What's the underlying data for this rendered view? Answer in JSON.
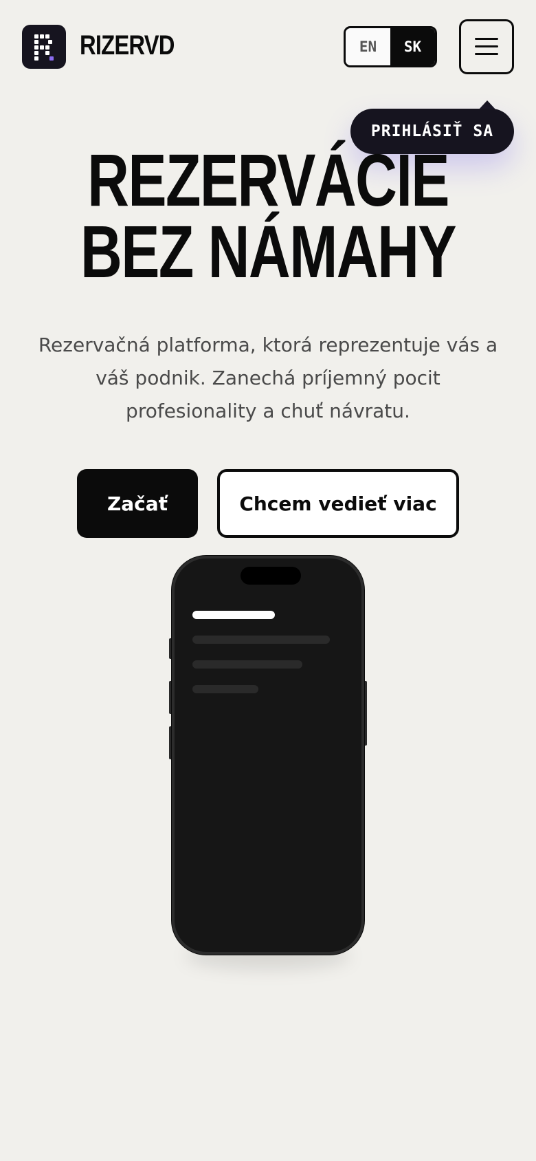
{
  "header": {
    "brand": "RIZERVD",
    "lang": {
      "en": "EN",
      "sk": "SK",
      "active": "SK"
    }
  },
  "tooltip": {
    "label": "PRIHLÁSIŤ SA"
  },
  "hero": {
    "title_line1": "REZERVÁCIE",
    "title_line2": "BEZ NÁMAHY",
    "subtitle": "Rezervačná platforma, ktorá reprezentuje vás a váš podnik. Zanechá príjemný pocit profesionality a chuť návratu.",
    "primary_cta": "Začať",
    "secondary_cta": "Chcem vedieť viac"
  },
  "colors": {
    "background": "#f1f0ec",
    "ink": "#0b0b0b",
    "logo_bg": "#16141f",
    "accent": "#8b6cf0",
    "phone_screen": "#161616"
  },
  "icons": [
    "logo-icon",
    "hamburger-icon"
  ]
}
